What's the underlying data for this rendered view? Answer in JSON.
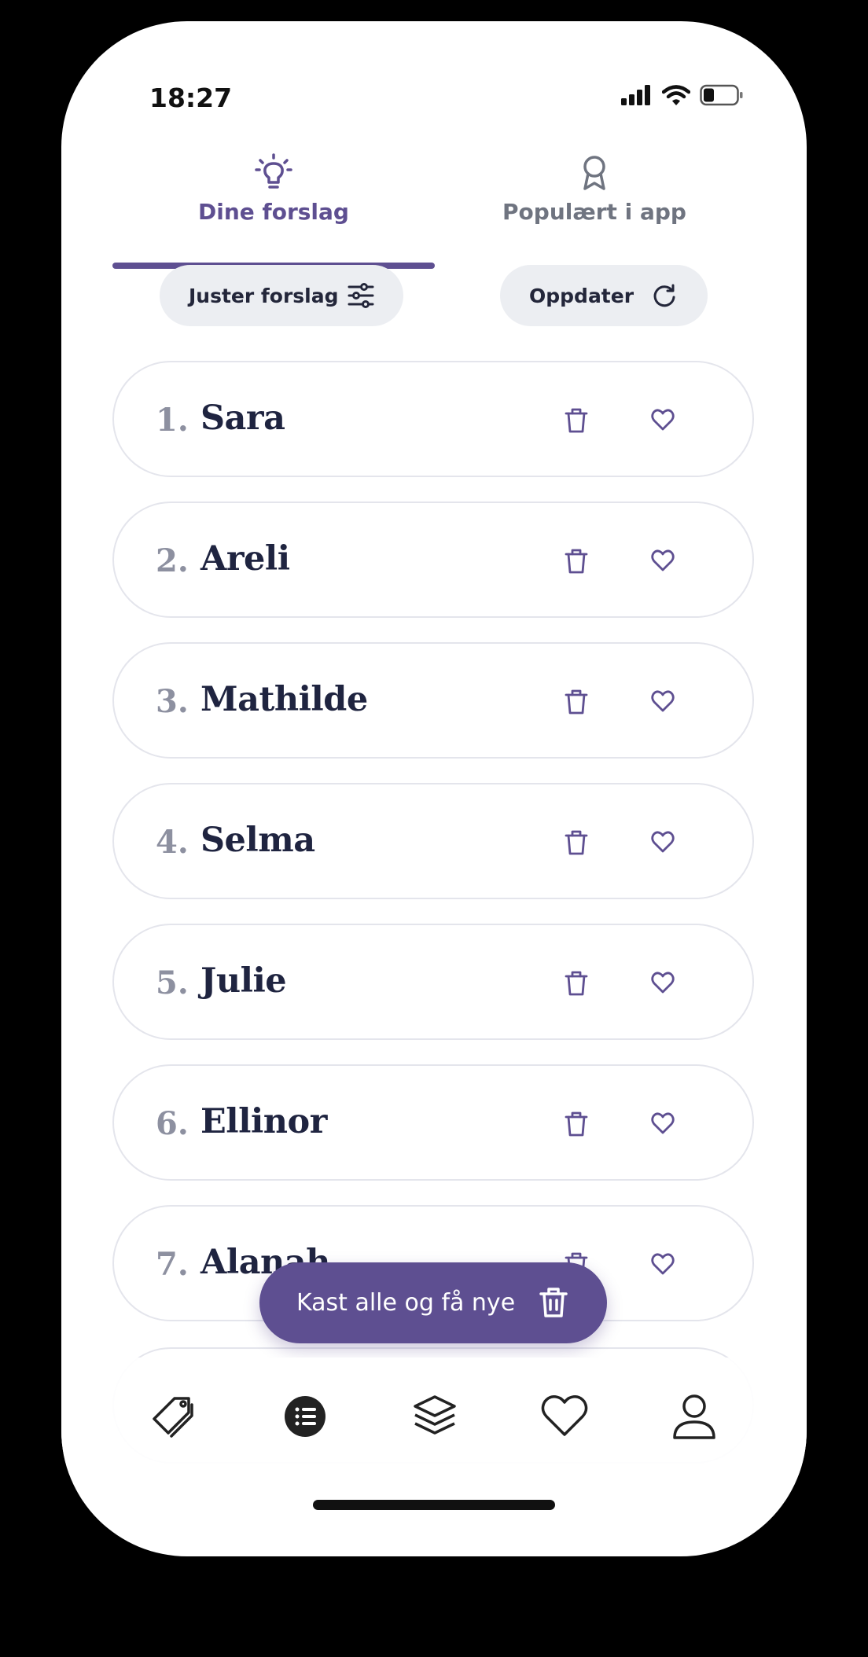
{
  "status_bar": {
    "time": "18:27"
  },
  "tabs": [
    {
      "label": "Dine forslag",
      "icon": "lightbulb-icon",
      "active": true
    },
    {
      "label": "Populært i app",
      "icon": "award-ribbon-icon",
      "active": false
    }
  ],
  "actions": {
    "adjust_label": "Juster forslag",
    "refresh_label": "Oppdater"
  },
  "suggestions": [
    {
      "number": "1.",
      "name": "Sara"
    },
    {
      "number": "2.",
      "name": "Areli"
    },
    {
      "number": "3.",
      "name": "Mathilde"
    },
    {
      "number": "4.",
      "name": "Selma"
    },
    {
      "number": "5.",
      "name": "Julie"
    },
    {
      "number": "6.",
      "name": "Ellinor"
    },
    {
      "number": "7.",
      "name": "Alanah"
    }
  ],
  "fab": {
    "label": "Kast alle og få nye"
  },
  "bottom_nav": {
    "items": [
      "tag-icon",
      "list-icon",
      "layers-icon",
      "heart-icon",
      "user-icon"
    ],
    "active": "list-icon"
  },
  "colors": {
    "accent": "#5e4f91",
    "name_text": "#1f2440",
    "number_text": "#8d90a0",
    "pill_bg": "#eceef2"
  }
}
